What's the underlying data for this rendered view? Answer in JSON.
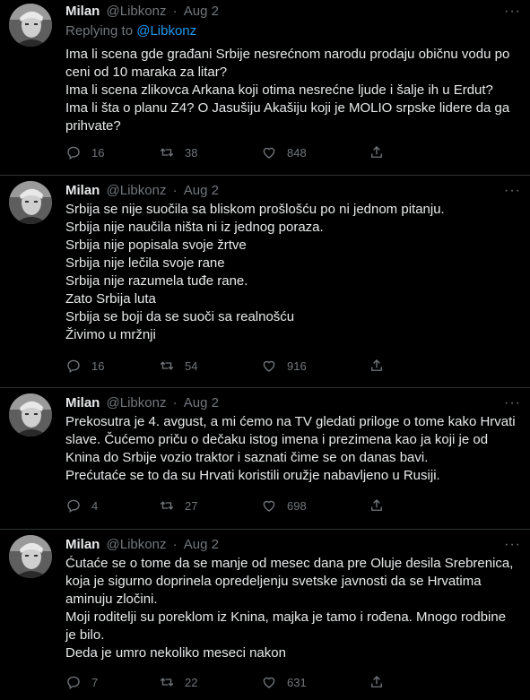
{
  "tweets": [
    {
      "name": "Milan",
      "handle": "@Libkonz",
      "date": "Aug 2",
      "replying_label": "Replying to",
      "replying_to": "@Libkonz",
      "lines": [
        "Ima li scena gde građani Srbije nesrećnom narodu prodaju običnu vodu po",
        "ceni od 10 maraka za litar?",
        "Ima li scena zlikovca Arkana koji otima nesrećne ljude i šalje ih u Erdut?",
        "Ima li šta o planu Z4? O Jasušiju Akašiju koji je MOLIO srpske lidere da ga",
        "prihvate?"
      ],
      "replies": "16",
      "retweets": "38",
      "likes": "848"
    },
    {
      "name": "Milan",
      "handle": "@Libkonz",
      "date": "Aug 2",
      "lines": [
        "Srbija se nije suočila sa bliskom prošlošću po ni jednom pitanju.",
        "Srbija nije naučila ništa ni iz jednog poraza.",
        "Srbija nije popisala svoje žrtve",
        "Srbija nije lečila svoje rane",
        "Srbija nije razumela tuđe rane.",
        "Zato Srbija luta",
        "Srbija se boji da se suoči sa realnošću",
        "Živimo u mržnji"
      ],
      "replies": "16",
      "retweets": "54",
      "likes": "916"
    },
    {
      "name": "Milan",
      "handle": "@Libkonz",
      "date": "Aug 2",
      "lines": [
        "Prekosutra je 4. avgust, a mi ćemo na TV gledati priloge o tome kako Hrvati",
        "slave. Čućemo priču o dečaku istog imena i prezimena kao ja koji je od",
        "Knina do Srbije vozio traktor i saznati čime se on danas bavi.",
        "Prećutaće se to da su Hrvati koristili oružje nabavljeno u Rusiji."
      ],
      "replies": "4",
      "retweets": "27",
      "likes": "698"
    },
    {
      "name": "Milan",
      "handle": "@Libkonz",
      "date": "Aug 2",
      "lines": [
        "Ćutaće se o tome da se manje od mesec dana pre Oluje desila Srebrenica,",
        "koja je sigurno doprinela opredeljenju svetske javnosti da se Hrvatima",
        "aminuju zločini.",
        "Moji roditelji su poreklom iz Knina, majka je tamo i rođena. Mnogo rodbine",
        "je bilo.",
        "Deda je umro nekoliko meseci nakon"
      ],
      "replies": "7",
      "retweets": "22",
      "likes": "631"
    }
  ],
  "icons": {
    "reply": "reply-icon",
    "retweet": "retweet-icon",
    "like": "heart-icon",
    "share": "share-icon",
    "more": "more-icon",
    "avatar": "avatar-photo"
  },
  "colors": {
    "background": "#000000",
    "text": "#e7e9ea",
    "muted": "#71767b",
    "link": "#1d9bf0",
    "divider": "#2f3336"
  }
}
